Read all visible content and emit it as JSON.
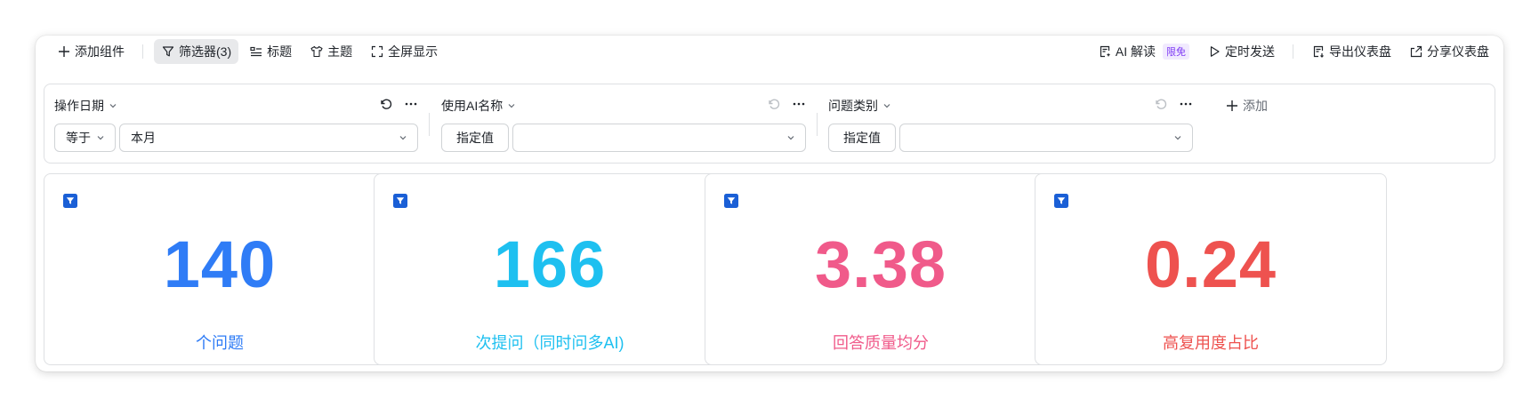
{
  "toolbar": {
    "add_widget": "添加组件",
    "filter": "筛选器(3)",
    "title": "标题",
    "theme": "主题",
    "fullscreen": "全屏显示",
    "ai_read": "AI 解读",
    "ai_badge": "限免",
    "schedule_send": "定时发送",
    "export_dashboard": "导出仪表盘",
    "share_dashboard": "分享仪表盘"
  },
  "filters": [
    {
      "title": "操作日期",
      "operator": "等于",
      "value": "本月"
    },
    {
      "title": "使用AI名称",
      "operator": "指定值",
      "value": ""
    },
    {
      "title": "问题类别",
      "operator": "指定值",
      "value": ""
    }
  ],
  "add_filter": "添加",
  "metrics": [
    {
      "value": "140",
      "label": "个问题",
      "color": "#2f7cf6"
    },
    {
      "value": "166",
      "label": "次提问（同时问多AI)",
      "color": "#1ec0f0"
    },
    {
      "value": "3.38",
      "label": "回答质量均分",
      "color": "#f05a8a"
    },
    {
      "value": "0.24",
      "label": "高复用度占比",
      "color": "#ee524f"
    }
  ],
  "colors": {
    "filter_icon": "#1a5fd6",
    "border": "#dee0e3"
  }
}
